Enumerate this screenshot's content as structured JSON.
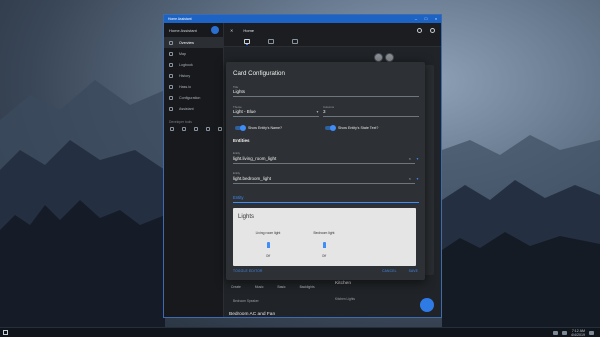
{
  "window": {
    "title": "Home Assistant",
    "controls": [
      "–",
      "□",
      "×"
    ]
  },
  "sidebar": {
    "app_title": "Home Assistant",
    "items": [
      {
        "label": "Overview",
        "active": true
      },
      {
        "label": "Map"
      },
      {
        "label": "Logbook"
      },
      {
        "label": "History"
      },
      {
        "label": "Hass.io"
      },
      {
        "label": "Configuration"
      },
      {
        "label": "Assistant"
      }
    ],
    "dev_tools_label": "Developer tools"
  },
  "topbar": {
    "back_icon": "arrow-left-icon",
    "title": "Home"
  },
  "background": {
    "bottom_nav": [
      "Create",
      "Music",
      "Basic",
      "Backlights"
    ],
    "kitchen": "Kitchen",
    "kitchen_sub": "Kitchen Lights",
    "section_label": "Bedroom Speaker",
    "bedroom_label": "Bedroom AC and Fan"
  },
  "dialog": {
    "title": "Card Configuration",
    "title_field": {
      "label": "Title",
      "value": "Lights"
    },
    "theme_field": {
      "label": "Theme",
      "value": "Light - Blue"
    },
    "columns_field": {
      "label": "Columns",
      "value": "3"
    },
    "show_name_toggle": {
      "label": "Show Entity's Name?",
      "on": true
    },
    "show_state_toggle": {
      "label": "Show Entity's State Text?",
      "on": true
    },
    "entities_heading": "Entities",
    "entities": [
      {
        "label": "Entity",
        "value": "light.living_room_light"
      },
      {
        "label": "Entity",
        "value": "light.bedroom_light"
      }
    ],
    "new_entity_placeholder": "Entity",
    "preview": {
      "title": "Lights",
      "entities": [
        {
          "name": "Living room light",
          "state": "Off"
        },
        {
          "name": "Bedroom light",
          "state": "Off"
        }
      ]
    },
    "footer": {
      "toggle_editor": "TOGGLE EDITOR",
      "cancel": "CANCEL",
      "save": "SAVE"
    }
  },
  "taskbar": {
    "time": "7:12 AM",
    "date": "4/4/2019"
  },
  "colors": {
    "accent": "#3f8df7",
    "titlebar": "#1d63c4",
    "dialog_bg": "#2d3034"
  }
}
